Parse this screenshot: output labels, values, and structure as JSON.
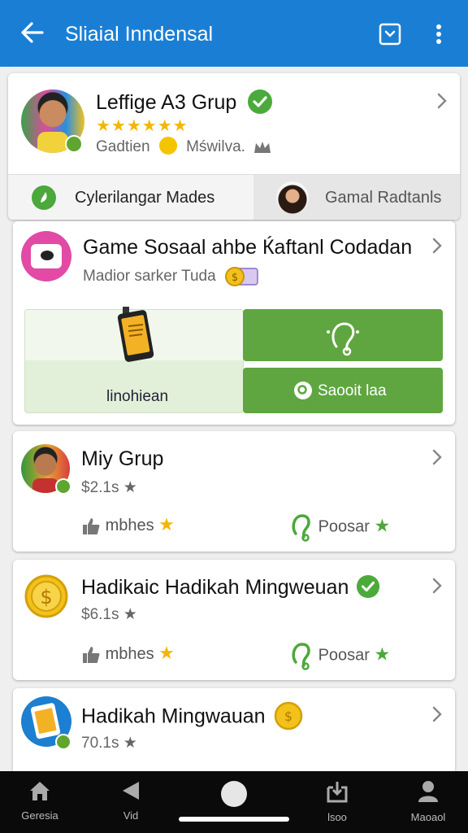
{
  "appbar": {
    "title": "Sliaial Inndensal",
    "back_icon": "arrow-left-icon",
    "action_icons": [
      "dropdown-box-icon",
      "more-vert-icon"
    ],
    "color": "#1a7fd4"
  },
  "header_card": {
    "title": "Leffige A3 Grup",
    "rating_stars": 6,
    "meta_left": "Gadtien",
    "meta_right": "Mświlva.",
    "tab_left": "Cylerilangar Mades",
    "tab_right": "Gamal Radtanls"
  },
  "game_card": {
    "title": "Game Sosaal ahbe Ќaftanl Codadan",
    "subtitle": "Madior sarker Tuda",
    "left_panel_label": "linohiean",
    "button_label": "Saooit laa",
    "accent": "#5fa640"
  },
  "groups": [
    {
      "title": "Miy Grup",
      "price": "$2.1s",
      "stat_left": "mbhes",
      "stat_right": "Poosar",
      "verified": false
    },
    {
      "title": "Hadikaic Hadikah Mingweuan",
      "price": "$6.1s",
      "stat_left": "mbhes",
      "stat_right": "Poosar",
      "verified": true
    },
    {
      "title": "Hadikah Mingwauan",
      "price": "70.1s",
      "stat_left": "",
      "stat_right": "",
      "verified": false
    }
  ],
  "bottom_nav": [
    {
      "label": "Geresia",
      "icon": "home-icon"
    },
    {
      "label": "Vid",
      "icon": "play-back-icon"
    },
    {
      "label": "",
      "icon": "home-circle-icon"
    },
    {
      "label": "lsoo",
      "icon": "download-box-icon"
    },
    {
      "label": "Maoaol",
      "icon": "person-icon"
    }
  ]
}
